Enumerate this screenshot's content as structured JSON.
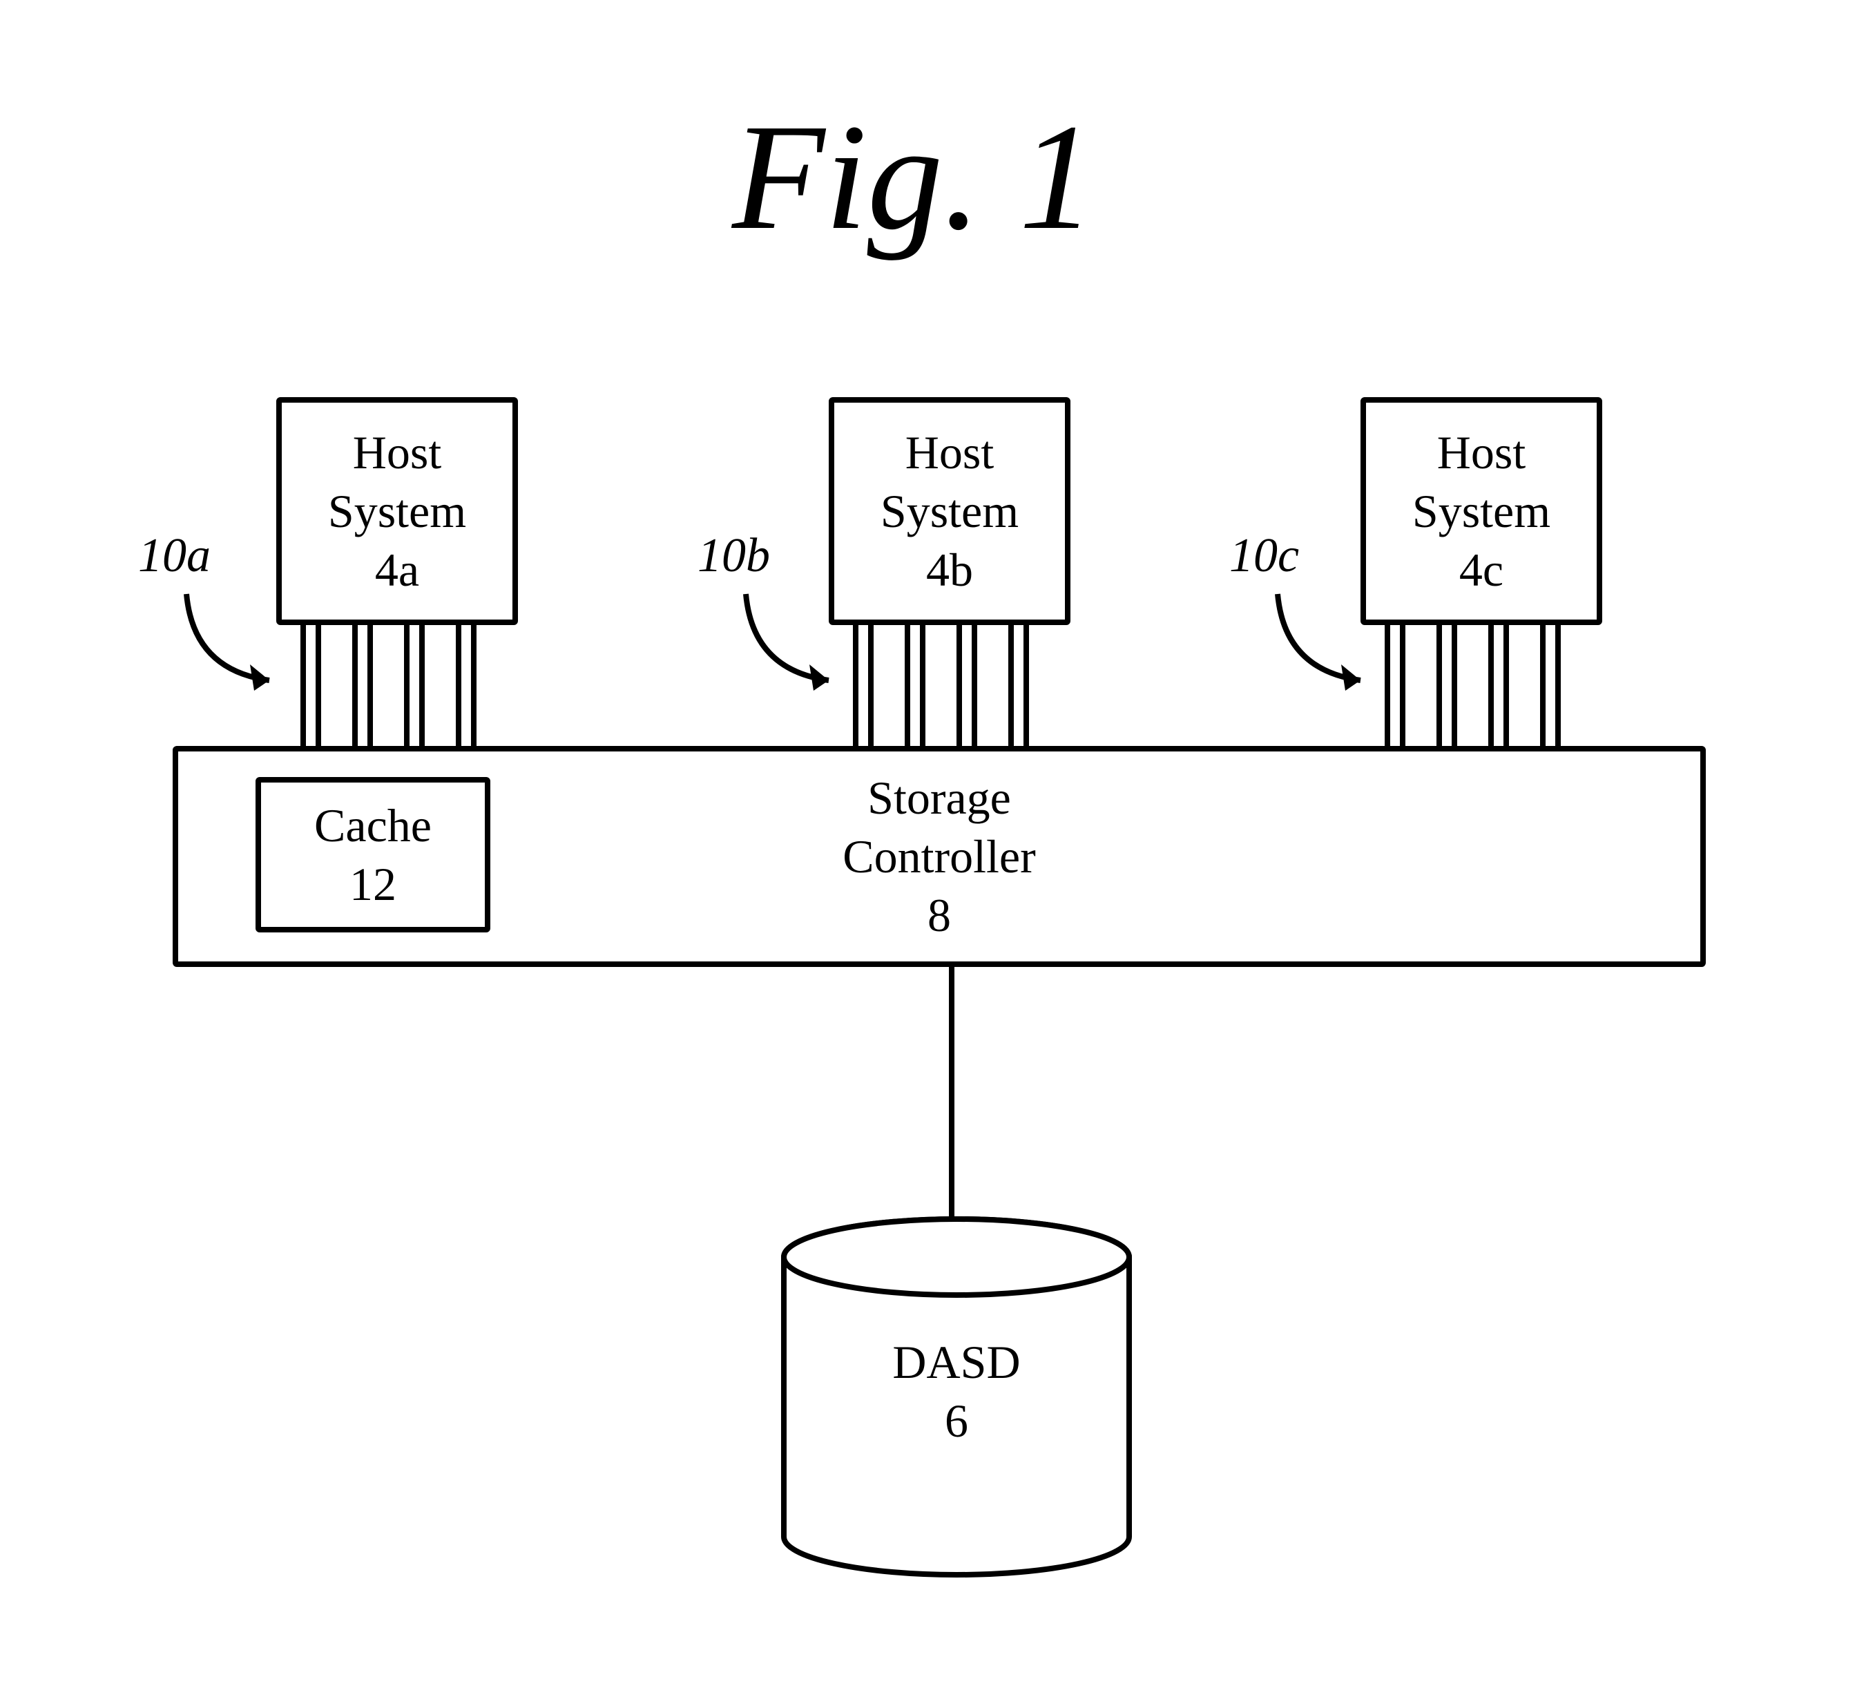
{
  "title": "Fig. 1",
  "hosts": [
    {
      "l1": "Host",
      "l2": "System",
      "l3": "4a",
      "ref": "10a"
    },
    {
      "l1": "Host",
      "l2": "System",
      "l3": "4b",
      "ref": "10b"
    },
    {
      "l1": "Host",
      "l2": "System",
      "l3": "4c",
      "ref": "10c"
    }
  ],
  "cache": {
    "l1": "Cache",
    "l2": "12"
  },
  "storage": {
    "l1": "Storage",
    "l2": "Controller",
    "l3": "8"
  },
  "dasd": {
    "l1": "DASD",
    "l2": "6"
  }
}
